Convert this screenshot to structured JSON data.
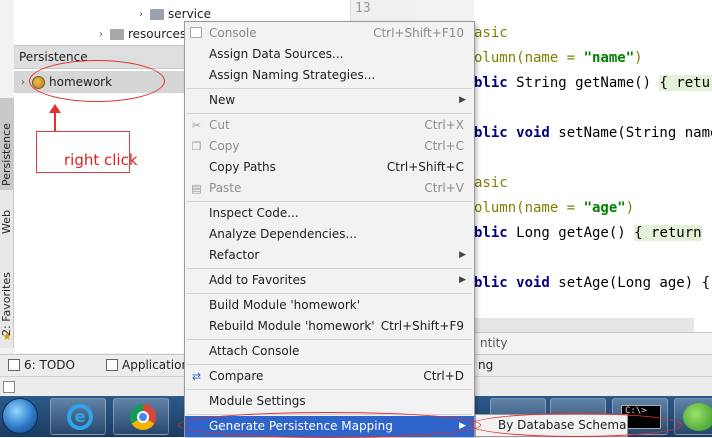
{
  "project_tree": {
    "items": [
      {
        "label": "service"
      },
      {
        "label": "resources"
      }
    ]
  },
  "gutter": {
    "line_number": "13"
  },
  "persistence": {
    "header": "Persistence",
    "item_label": "homework"
  },
  "side_tabs": {
    "persistence": "Persistence",
    "web": "Web",
    "favorites": "2: Favorites"
  },
  "annotation": {
    "text": "right click"
  },
  "editor": {
    "lines": [
      {
        "t1": "asic"
      },
      {
        "t1": "olumn(name = ",
        "str": "\"name\"",
        "t2": ")"
      },
      {
        "kw": "blic",
        "t1": " String getName() ",
        "t2": "{ retur"
      },
      {
        "kw": "blic void",
        "t1": " setName(String name"
      },
      {
        "t1": "asic"
      },
      {
        "t1": "olumn(name = ",
        "str": "\"age\"",
        "t2": ")"
      },
      {
        "kw": "blic",
        "t1": " Long getAge() ",
        "t2": "{ return"
      },
      {
        "kw": "blic void",
        "t1": " setAge(Long age) {"
      }
    ]
  },
  "bottom": {
    "split_text": "ntity",
    "todo_tab": "6: TODO",
    "app_tab": "Application",
    "hidden_tab": "ng"
  },
  "context_menu": {
    "items": [
      {
        "label": "Console",
        "shortcut": "Ctrl+Shift+F10",
        "disabled": true,
        "icon": "console-icon"
      },
      {
        "label": "Assign Data Sources..."
      },
      {
        "label": "Assign Naming Strategies..."
      },
      {
        "label": "New",
        "submenu": true
      },
      {
        "label": "Cut",
        "shortcut": "Ctrl+X",
        "disabled": true,
        "icon": "cut-icon"
      },
      {
        "label": "Copy",
        "shortcut": "Ctrl+C",
        "disabled": true,
        "icon": "copy-icon"
      },
      {
        "label": "Copy Paths",
        "shortcut": "Ctrl+Shift+C"
      },
      {
        "label": "Paste",
        "shortcut": "Ctrl+V",
        "disabled": true,
        "icon": "paste-icon"
      },
      {
        "label": "Inspect Code..."
      },
      {
        "label": "Analyze Dependencies..."
      },
      {
        "label": "Refactor",
        "submenu": true
      },
      {
        "label": "Add to Favorites",
        "submenu": true
      },
      {
        "label": "Build Module 'homework'"
      },
      {
        "label": "Rebuild Module 'homework'",
        "shortcut": "Ctrl+Shift+F9"
      },
      {
        "label": "Attach Console"
      },
      {
        "label": "Compare",
        "shortcut": "Ctrl+D",
        "icon": "compare-icon"
      },
      {
        "label": "Module Settings"
      },
      {
        "label": "Generate Persistence Mapping",
        "submenu": true,
        "selected": true
      }
    ]
  },
  "submenu": {
    "label": "By Database Schema"
  },
  "taskbar": {
    "cmd_text": "C:\\>"
  },
  "colors": {
    "selection": "#2f65ca",
    "annotation": "#e03030"
  }
}
